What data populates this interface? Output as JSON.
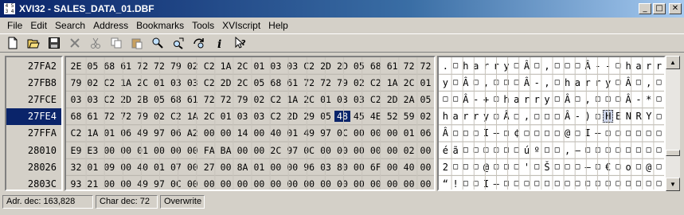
{
  "window": {
    "title": "XVI32 - SALES_DATA_01.DBF",
    "icon_text": "4 5 3 4",
    "min_label": "_",
    "max_label": "□",
    "close_label": "✕"
  },
  "menu": [
    {
      "label": "File"
    },
    {
      "label": "Edit"
    },
    {
      "label": "Search"
    },
    {
      "label": "Address"
    },
    {
      "label": "Bookmarks"
    },
    {
      "label": "Tools"
    },
    {
      "label": "XVIscript"
    },
    {
      "label": "Help"
    }
  ],
  "toolbar": [
    {
      "name": "new-file-icon"
    },
    {
      "name": "open-folder-icon"
    },
    {
      "name": "save-icon"
    },
    {
      "name": "close-x-icon"
    },
    {
      "name": "cut-icon"
    },
    {
      "name": "copy-icon"
    },
    {
      "name": "paste-icon"
    },
    {
      "name": "find-icon"
    },
    {
      "name": "replace-icon"
    },
    {
      "name": "find-next-icon"
    },
    {
      "name": "info-icon"
    },
    {
      "name": "context-help-icon"
    }
  ],
  "addresses": [
    "27FA2",
    "27FB8",
    "27FCE",
    "27FE4",
    "27FFA",
    "28010",
    "28026",
    "2803C"
  ],
  "selected_row": 3,
  "hex_rows": [
    [
      "2E",
      "05",
      "68",
      "61",
      "72",
      "72",
      "79",
      "02",
      "C2",
      "1A",
      "2C",
      "01",
      "03",
      "03",
      "C2",
      "2D",
      "2D",
      "05",
      "68",
      "61",
      "72",
      "72"
    ],
    [
      "79",
      "02",
      "C2",
      "1A",
      "2C",
      "01",
      "03",
      "03",
      "C2",
      "2D",
      "2C",
      "05",
      "68",
      "61",
      "72",
      "72",
      "79",
      "02",
      "C2",
      "1A",
      "2C",
      "01"
    ],
    [
      "03",
      "03",
      "C2",
      "2D",
      "2B",
      "05",
      "68",
      "61",
      "72",
      "72",
      "79",
      "02",
      "C2",
      "1A",
      "2C",
      "01",
      "03",
      "03",
      "C2",
      "2D",
      "2A",
      "05"
    ],
    [
      "68",
      "61",
      "72",
      "72",
      "79",
      "02",
      "C2",
      "1A",
      "2C",
      "01",
      "03",
      "03",
      "C2",
      "2D",
      "29",
      "05",
      "48",
      "45",
      "4E",
      "52",
      "59",
      "02"
    ],
    [
      "C2",
      "1A",
      "01",
      "06",
      "49",
      "97",
      "06",
      "A2",
      "00",
      "00",
      "14",
      "00",
      "40",
      "01",
      "49",
      "97",
      "0C",
      "00",
      "00",
      "00",
      "01",
      "06"
    ],
    [
      "E9",
      "E3",
      "00",
      "00",
      "01",
      "00",
      "00",
      "00",
      "FA",
      "BA",
      "00",
      "00",
      "2C",
      "97",
      "0C",
      "00",
      "00",
      "00",
      "00",
      "00",
      "02",
      "00"
    ],
    [
      "32",
      "01",
      "09",
      "00",
      "40",
      "01",
      "07",
      "00",
      "27",
      "00",
      "8A",
      "01",
      "00",
      "00",
      "96",
      "03",
      "80",
      "00",
      "6F",
      "00",
      "40",
      "00"
    ],
    [
      "93",
      "21",
      "00",
      "00",
      "49",
      "97",
      "0C",
      "00",
      "00",
      "00",
      "00",
      "00",
      "00",
      "00",
      "00",
      "00",
      "00",
      "00",
      "00",
      "00",
      "00",
      "00"
    ]
  ],
  "selected_hex": {
    "row": 3,
    "col": 16
  },
  "text_rows": [
    [
      ".",
      "□",
      "h",
      "a",
      "r",
      "r",
      "y",
      "□",
      "Â",
      "□",
      ",",
      "□",
      "□",
      "□",
      "Â",
      "-",
      "-",
      "□",
      "h",
      "a",
      "r",
      "r"
    ],
    [
      "y",
      "□",
      "Â",
      "□",
      ",",
      "□",
      "□",
      "□",
      "Â",
      "-",
      ",",
      "□",
      "h",
      "a",
      "r",
      "r",
      "y",
      "□",
      "Â",
      "□",
      ",",
      "□"
    ],
    [
      "□",
      "□",
      "Â",
      "-",
      "+",
      "□",
      "h",
      "a",
      "r",
      "r",
      "y",
      "□",
      "Â",
      "□",
      ",",
      "□",
      "□",
      "□",
      "Â",
      "-",
      "*",
      "□"
    ],
    [
      "h",
      "a",
      "r",
      "r",
      "y",
      "□",
      "Â",
      "□",
      ",",
      "□",
      "□",
      "□",
      "Â",
      "-",
      ")",
      "□",
      "H",
      "E",
      "N",
      "R",
      "Y",
      "□"
    ],
    [
      "Â",
      "□",
      "□",
      "□",
      "I",
      "—",
      "□",
      "¢",
      "□",
      "□",
      "□",
      "□",
      "@",
      "□",
      "I",
      "—",
      "□",
      "□",
      "□",
      "□",
      "□",
      "□"
    ],
    [
      "é",
      "ã",
      "□",
      "□",
      "□",
      "□",
      "□",
      "□",
      "ú",
      "º",
      "□",
      "□",
      ",",
      "—",
      "□",
      "□",
      "□",
      "□",
      "□",
      "□",
      "□",
      "□"
    ],
    [
      "2",
      "□",
      "□",
      "□",
      "@",
      "□",
      "□",
      "□",
      "'",
      "□",
      "Š",
      "□",
      "□",
      "□",
      "–",
      "□",
      "€",
      "□",
      "o",
      "□",
      "@",
      "□"
    ],
    [
      "“",
      "!",
      "□",
      "□",
      "I",
      "—",
      "□",
      "□",
      "□",
      "□",
      "□",
      "□",
      "□",
      "□",
      "□",
      "□",
      "□",
      "□",
      "□",
      "□",
      "□",
      "□"
    ]
  ],
  "cursor_text": {
    "row": 3,
    "col": 16
  },
  "status": {
    "addr": "Adr. dec: 163,828",
    "char": "Char dec: 72",
    "mode": "Overwrite"
  }
}
